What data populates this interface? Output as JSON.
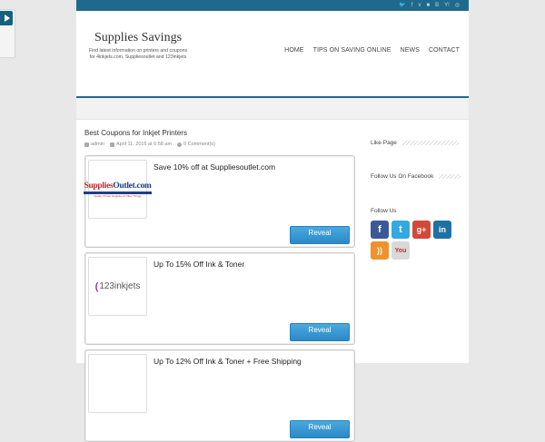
{
  "topbar": {
    "social": [
      "twitter-icon",
      "facebook-icon",
      "vimeo-icon",
      "delicious-icon",
      "blogger-icon",
      "yahoo-icon",
      "rss-icon"
    ],
    "colors": {
      "bar": "#1f6a8c"
    }
  },
  "site": {
    "title": "Supplies Savings",
    "tagline": "Find latest information on printers and coupons for 4inkjets.com, Suppliesoutlet and 123inkjets"
  },
  "nav": [
    "HOME",
    "TIPS ON SAVING ONLINE",
    "NEWS",
    "CONTACT"
  ],
  "post": {
    "title": "Best Coupons for Inkjet Printers",
    "author": "admin",
    "date": "April 11, 2016 at 6:58 am",
    "comments": "0 Comment(s)"
  },
  "coupons": [
    {
      "title": "Save 10% off at Suppliesoutlet.com",
      "button": "Reveal",
      "logo": {
        "part1": "Supplies",
        "part2": "Outlet.com",
        "sub": "Quality Printer Supplies & Other Things"
      }
    },
    {
      "title": "Up To 15% Off Ink & Toner",
      "button": "Reveal",
      "logo": {
        "text": "123inkjets"
      }
    },
    {
      "title": "Up To 12% Off Ink & Toner + Free Shipping",
      "button": "Reveal",
      "logo": {}
    }
  ],
  "sidebar": {
    "like_page": "Like Page",
    "follow_facebook": "Follow Us On Facebook",
    "follow_us": "Follow Us",
    "icons": [
      {
        "name": "facebook-icon",
        "glyph": "f",
        "color": "#3b5998"
      },
      {
        "name": "twitter-icon",
        "glyph": "t",
        "color": "#33a9e1"
      },
      {
        "name": "google-plus-icon",
        "glyph": "g+",
        "color": "#d34836"
      },
      {
        "name": "linkedin-icon",
        "glyph": "in",
        "color": "#1f71a4"
      },
      {
        "name": "rss-icon",
        "glyph": "))",
        "color": "#f0912b"
      },
      {
        "name": "youtube-icon",
        "glyph": "You",
        "color": "#d9d9d9"
      }
    ]
  }
}
